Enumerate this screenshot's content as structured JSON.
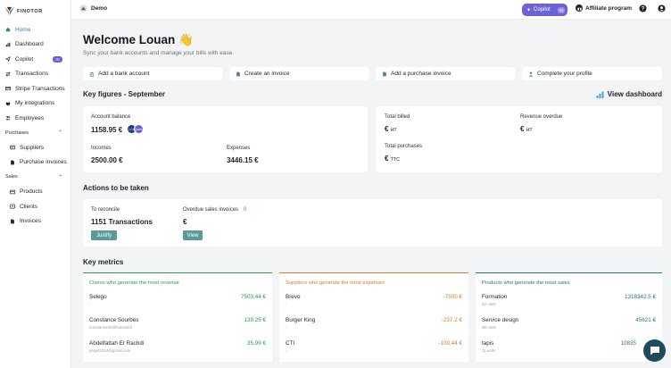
{
  "brand": {
    "name": "FINOTOR"
  },
  "sidebar": {
    "items": [
      {
        "label": "Home",
        "icon": "home-icon"
      },
      {
        "label": "Dashboard",
        "icon": "bar-chart-icon"
      },
      {
        "label": "Copilot",
        "icon": "send-icon",
        "badge": "AI"
      },
      {
        "label": "Transactions",
        "icon": "swap-icon"
      },
      {
        "label": "Stripe Transactions",
        "icon": "card-icon"
      },
      {
        "label": "My integrations",
        "icon": "plug-icon"
      },
      {
        "label": "Employees",
        "icon": "people-icon"
      }
    ],
    "purchases": {
      "title": "Purchases",
      "items": [
        {
          "label": "Suppliers",
          "icon": "suppliers-icon"
        },
        {
          "label": "Purchase invoices",
          "icon": "document-icon"
        }
      ]
    },
    "sales": {
      "title": "Sales",
      "items": [
        {
          "label": "Products",
          "icon": "box-icon"
        },
        {
          "label": "Clients",
          "icon": "client-icon"
        },
        {
          "label": "Invoices",
          "icon": "invoice-icon"
        }
      ]
    }
  },
  "topbar": {
    "org_name": "Demo",
    "copilot_label": "Copilot",
    "copilot_badge": "AI",
    "affiliate_label": "Affiliate program"
  },
  "welcome": {
    "title": "Welcome Louan 👋",
    "subtitle": "Sync your bank accounts and manage your bills with ease."
  },
  "quick_actions": [
    {
      "label": "Add a bank account"
    },
    {
      "label": "Create an invoice"
    },
    {
      "label": "Add a purchase invoice"
    },
    {
      "label": "Complete your profile"
    }
  ],
  "key_figures": {
    "title": "Key figures - September",
    "view_dashboard": "View dashboard",
    "account_balance_label": "Account balance",
    "account_balance": "1158.95 €",
    "bank_avatars": [
      "LCL",
      "Qonto"
    ],
    "incomes_label": "Incomes",
    "incomes": "2500.00 €",
    "expenses_label": "Expenses",
    "expenses": "3446.15 €",
    "total_billed_label": "Total billed",
    "total_billed_currency": "€",
    "total_billed_unit": "HT",
    "revenue_overdue_label": "Revenue overdue",
    "revenue_overdue_currency": "€",
    "revenue_overdue_unit": "HT",
    "total_purchases_label": "Total purchases",
    "total_purchases_currency": "€",
    "total_purchases_unit": "TTC"
  },
  "actions": {
    "title": "Actions to be taken",
    "reconcile_label": "To reconcile",
    "reconcile_value": "1151 Transactions",
    "justify_label": "Justify",
    "overdue_label": "Overdue sales invoices",
    "overdue_count": "0",
    "overdue_value": "€",
    "view_label": "View"
  },
  "metrics": {
    "title": "Key metrics",
    "colors": {
      "clients": "#2e9a4a",
      "suppliers": "#e07a2a",
      "products": "#2a6f88"
    },
    "clients": {
      "title": "Clients who generate the most revenue",
      "rows": [
        {
          "name": "Selego",
          "sub": "-",
          "value": "7503.44 €"
        },
        {
          "name": "Constance Sourbes",
          "sub": "constance20@hotmail.fr",
          "value": "139.25 €"
        },
        {
          "name": "Abdelfattah Er Rachdi",
          "sub": "projet2024@gmail.com",
          "value": "35.99 €"
        }
      ]
    },
    "suppliers": {
      "title": "Suppliers who generate the most expenses",
      "rows": [
        {
          "name": "Brevo",
          "sub": "-",
          "value": "-7500 €"
        },
        {
          "name": "Burger King",
          "sub": "-",
          "value": "-237.2 €"
        },
        {
          "name": "CTI",
          "sub": "-",
          "value": "-100.44 €"
        }
      ]
    },
    "products": {
      "title": "Products who generate the most sales",
      "rows": [
        {
          "name": "Formation",
          "sub": "62 units",
          "value": "1318342.5 €"
        },
        {
          "name": "Service design",
          "sub": "38 units",
          "value": "45621 €"
        },
        {
          "name": "tapis",
          "sub": "11 units",
          "value": "10835"
        }
      ]
    }
  }
}
